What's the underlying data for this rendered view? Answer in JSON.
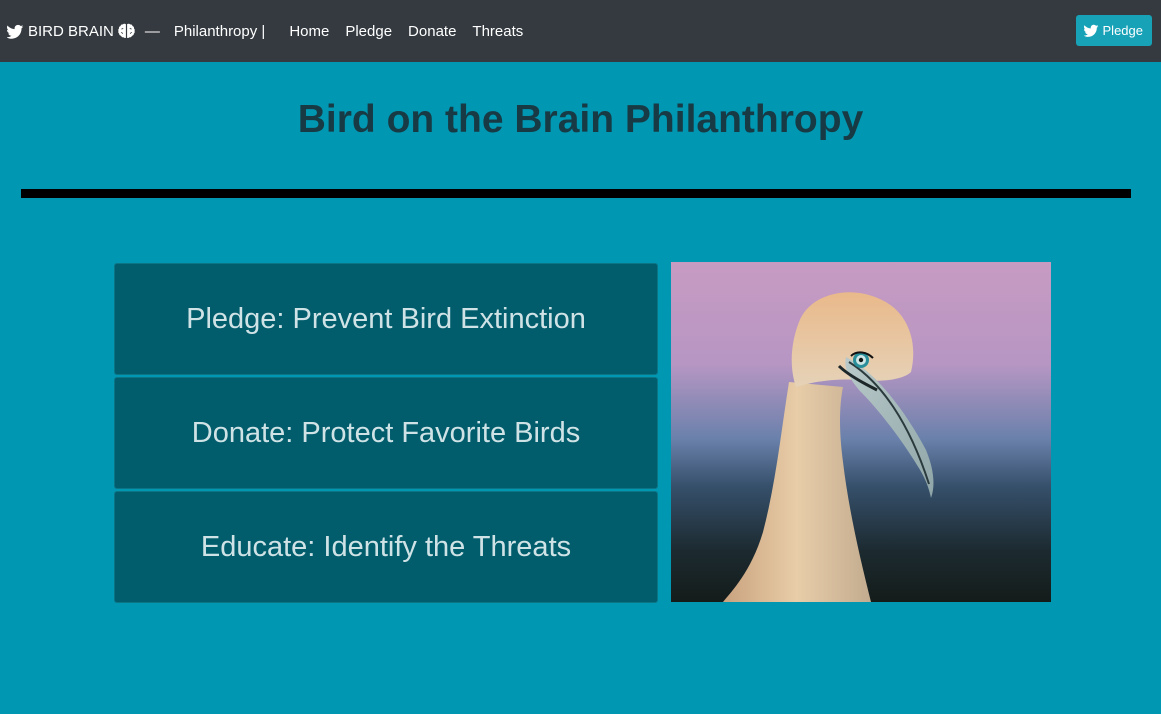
{
  "navbar": {
    "brand_text": "BIRD BRAIN",
    "separator": "—",
    "section_label": "Philanthropy |",
    "links": [
      "Home",
      "Pledge",
      "Donate",
      "Threats"
    ],
    "pledge_button_label": "Pledge",
    "background": "#343a40",
    "button_color": "#17a2b8"
  },
  "page": {
    "title": "Bird on the Brain Philanthropy",
    "background": "#0097b2"
  },
  "cards": [
    {
      "label": "Pledge: Prevent Bird Extinction"
    },
    {
      "label": "Donate: Protect Favorite Birds"
    },
    {
      "label": "Educate: Identify the Threats"
    }
  ],
  "icons": {
    "bird": "bird-icon",
    "brain": "brain-icon"
  }
}
